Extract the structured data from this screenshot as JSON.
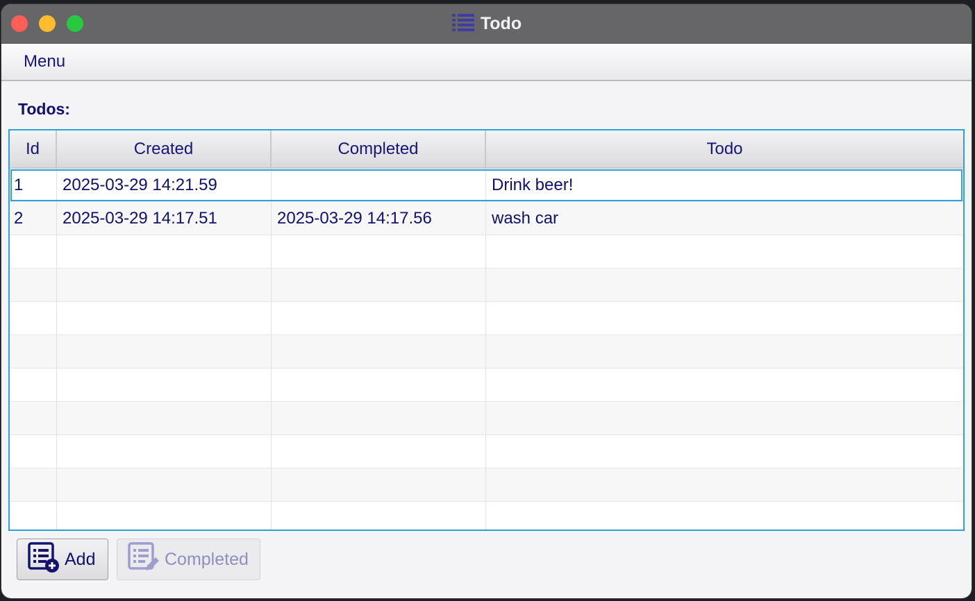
{
  "window": {
    "title": "Todo",
    "title_icon": "list-icon"
  },
  "menubar": {
    "items": [
      {
        "label": "Menu"
      }
    ]
  },
  "main": {
    "section_label": "Todos:",
    "table": {
      "columns": [
        "Id",
        "Created",
        "Completed",
        "Todo"
      ],
      "rows": [
        {
          "id": "1",
          "created": "2025-03-29 14:21.59",
          "completed": "",
          "todo": "Drink beer!"
        },
        {
          "id": "2",
          "created": "2025-03-29 14:17.51",
          "completed": "2025-03-29 14:17.56",
          "todo": "wash car"
        }
      ],
      "selected_row": 0
    }
  },
  "buttons": {
    "add_label": "Add",
    "add_icon": "add-list-icon",
    "completed_label": "Completed",
    "completed_icon": "edit-list-icon",
    "completed_enabled": false
  },
  "colors": {
    "accent": "#2ba3d8",
    "text": "#10106e",
    "titlebar": "#666668"
  }
}
